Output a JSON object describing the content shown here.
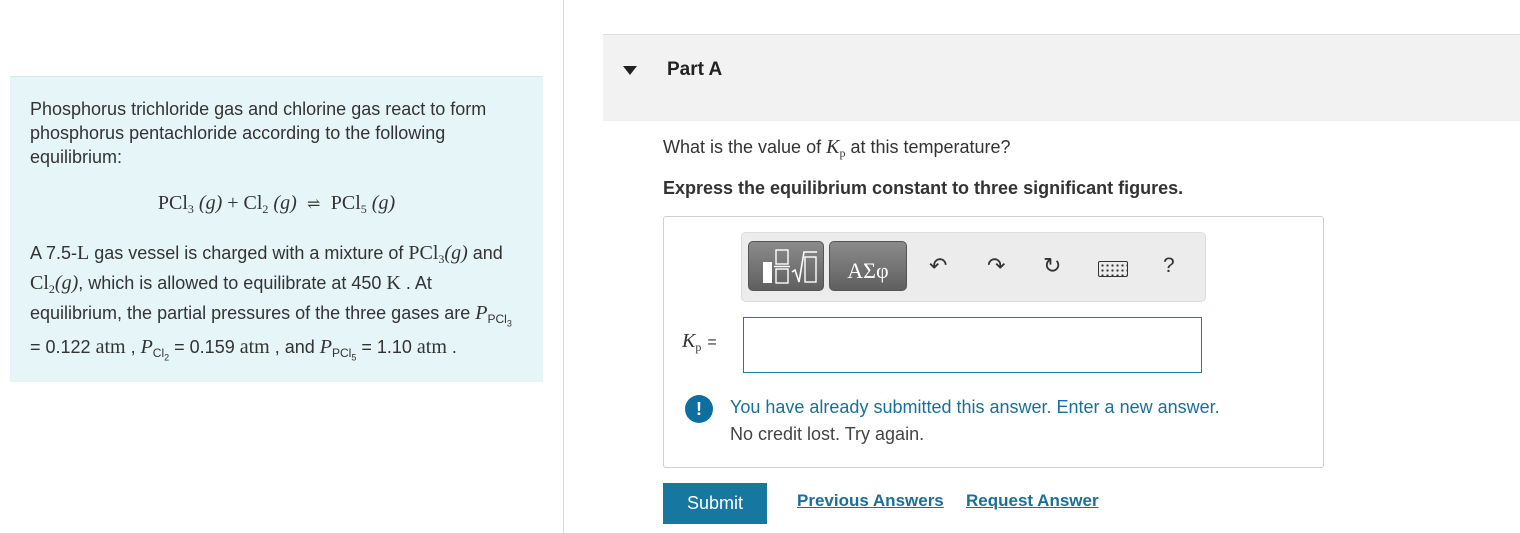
{
  "problem": {
    "intro": "Phosphorus trichloride gas and chlorine gas react to form phosphorus pentachloride according to the following equilibrium:",
    "equation": {
      "r1_base": "PCl",
      "r1_sub": "3",
      "r1_phase": "(g)",
      "plus": "+",
      "r2_base": "Cl",
      "r2_sub": "2",
      "r2_phase": "(g)",
      "arrow": "⇌",
      "p_base": "PCl",
      "p_sub": "5",
      "p_phase": "(g)"
    },
    "details": {
      "t1": "A 7.5-",
      "vol_unit": "L",
      "t2": " gas vessel is charged with a mixture of ",
      "sp1": "PCl",
      "sp1_sub": "3",
      "sp1_phase": "(g)",
      "t3": " and ",
      "sp2": "Cl",
      "sp2_sub": "2",
      "sp2_phase": "(g)",
      "t4": ", which is allowed to equilibrate at 450 ",
      "temp_unit": "K",
      "t5": " . At equilibrium, the partial pressures of the three gases are ",
      "p_sym": "P",
      "p1_sub": "PCl",
      "p1_subsub": "3",
      "p1_val": " = 0.122 ",
      "atm": "atm",
      "sep1": " , ",
      "p2_sub": "Cl",
      "p2_subsub": "2",
      "p2_val": " = 0.159 ",
      "sep2": " , and ",
      "p3_sub": "PCl",
      "p3_subsub": "5",
      "p3_val": " = 1.10 ",
      "end": " ."
    }
  },
  "part": {
    "title": "Part A",
    "question_pre": "What is the value of ",
    "kp_k": "K",
    "kp_sub": "p",
    "question_post": " at this temperature?",
    "instruction": "Express the equilibrium constant to three significant figures."
  },
  "toolbar": {
    "symbols_label": "ΑΣφ",
    "undo_icon": "↶",
    "redo_icon": "↷",
    "reset_icon": "↻",
    "help_label": "?"
  },
  "answer": {
    "label_k": "K",
    "label_sub": "p",
    "equals": "=",
    "value": ""
  },
  "feedback": {
    "icon": "!",
    "line1": "You have already submitted this answer. Enter a new answer.",
    "line2": "No credit lost. Try again."
  },
  "actions": {
    "submit": "Submit",
    "previous_answers": "Previous Answers",
    "request_answer": "Request Answer"
  },
  "colors": {
    "problem_bg": "#e6f5f7",
    "accent": "#1677a0",
    "link": "#1a6f99"
  }
}
